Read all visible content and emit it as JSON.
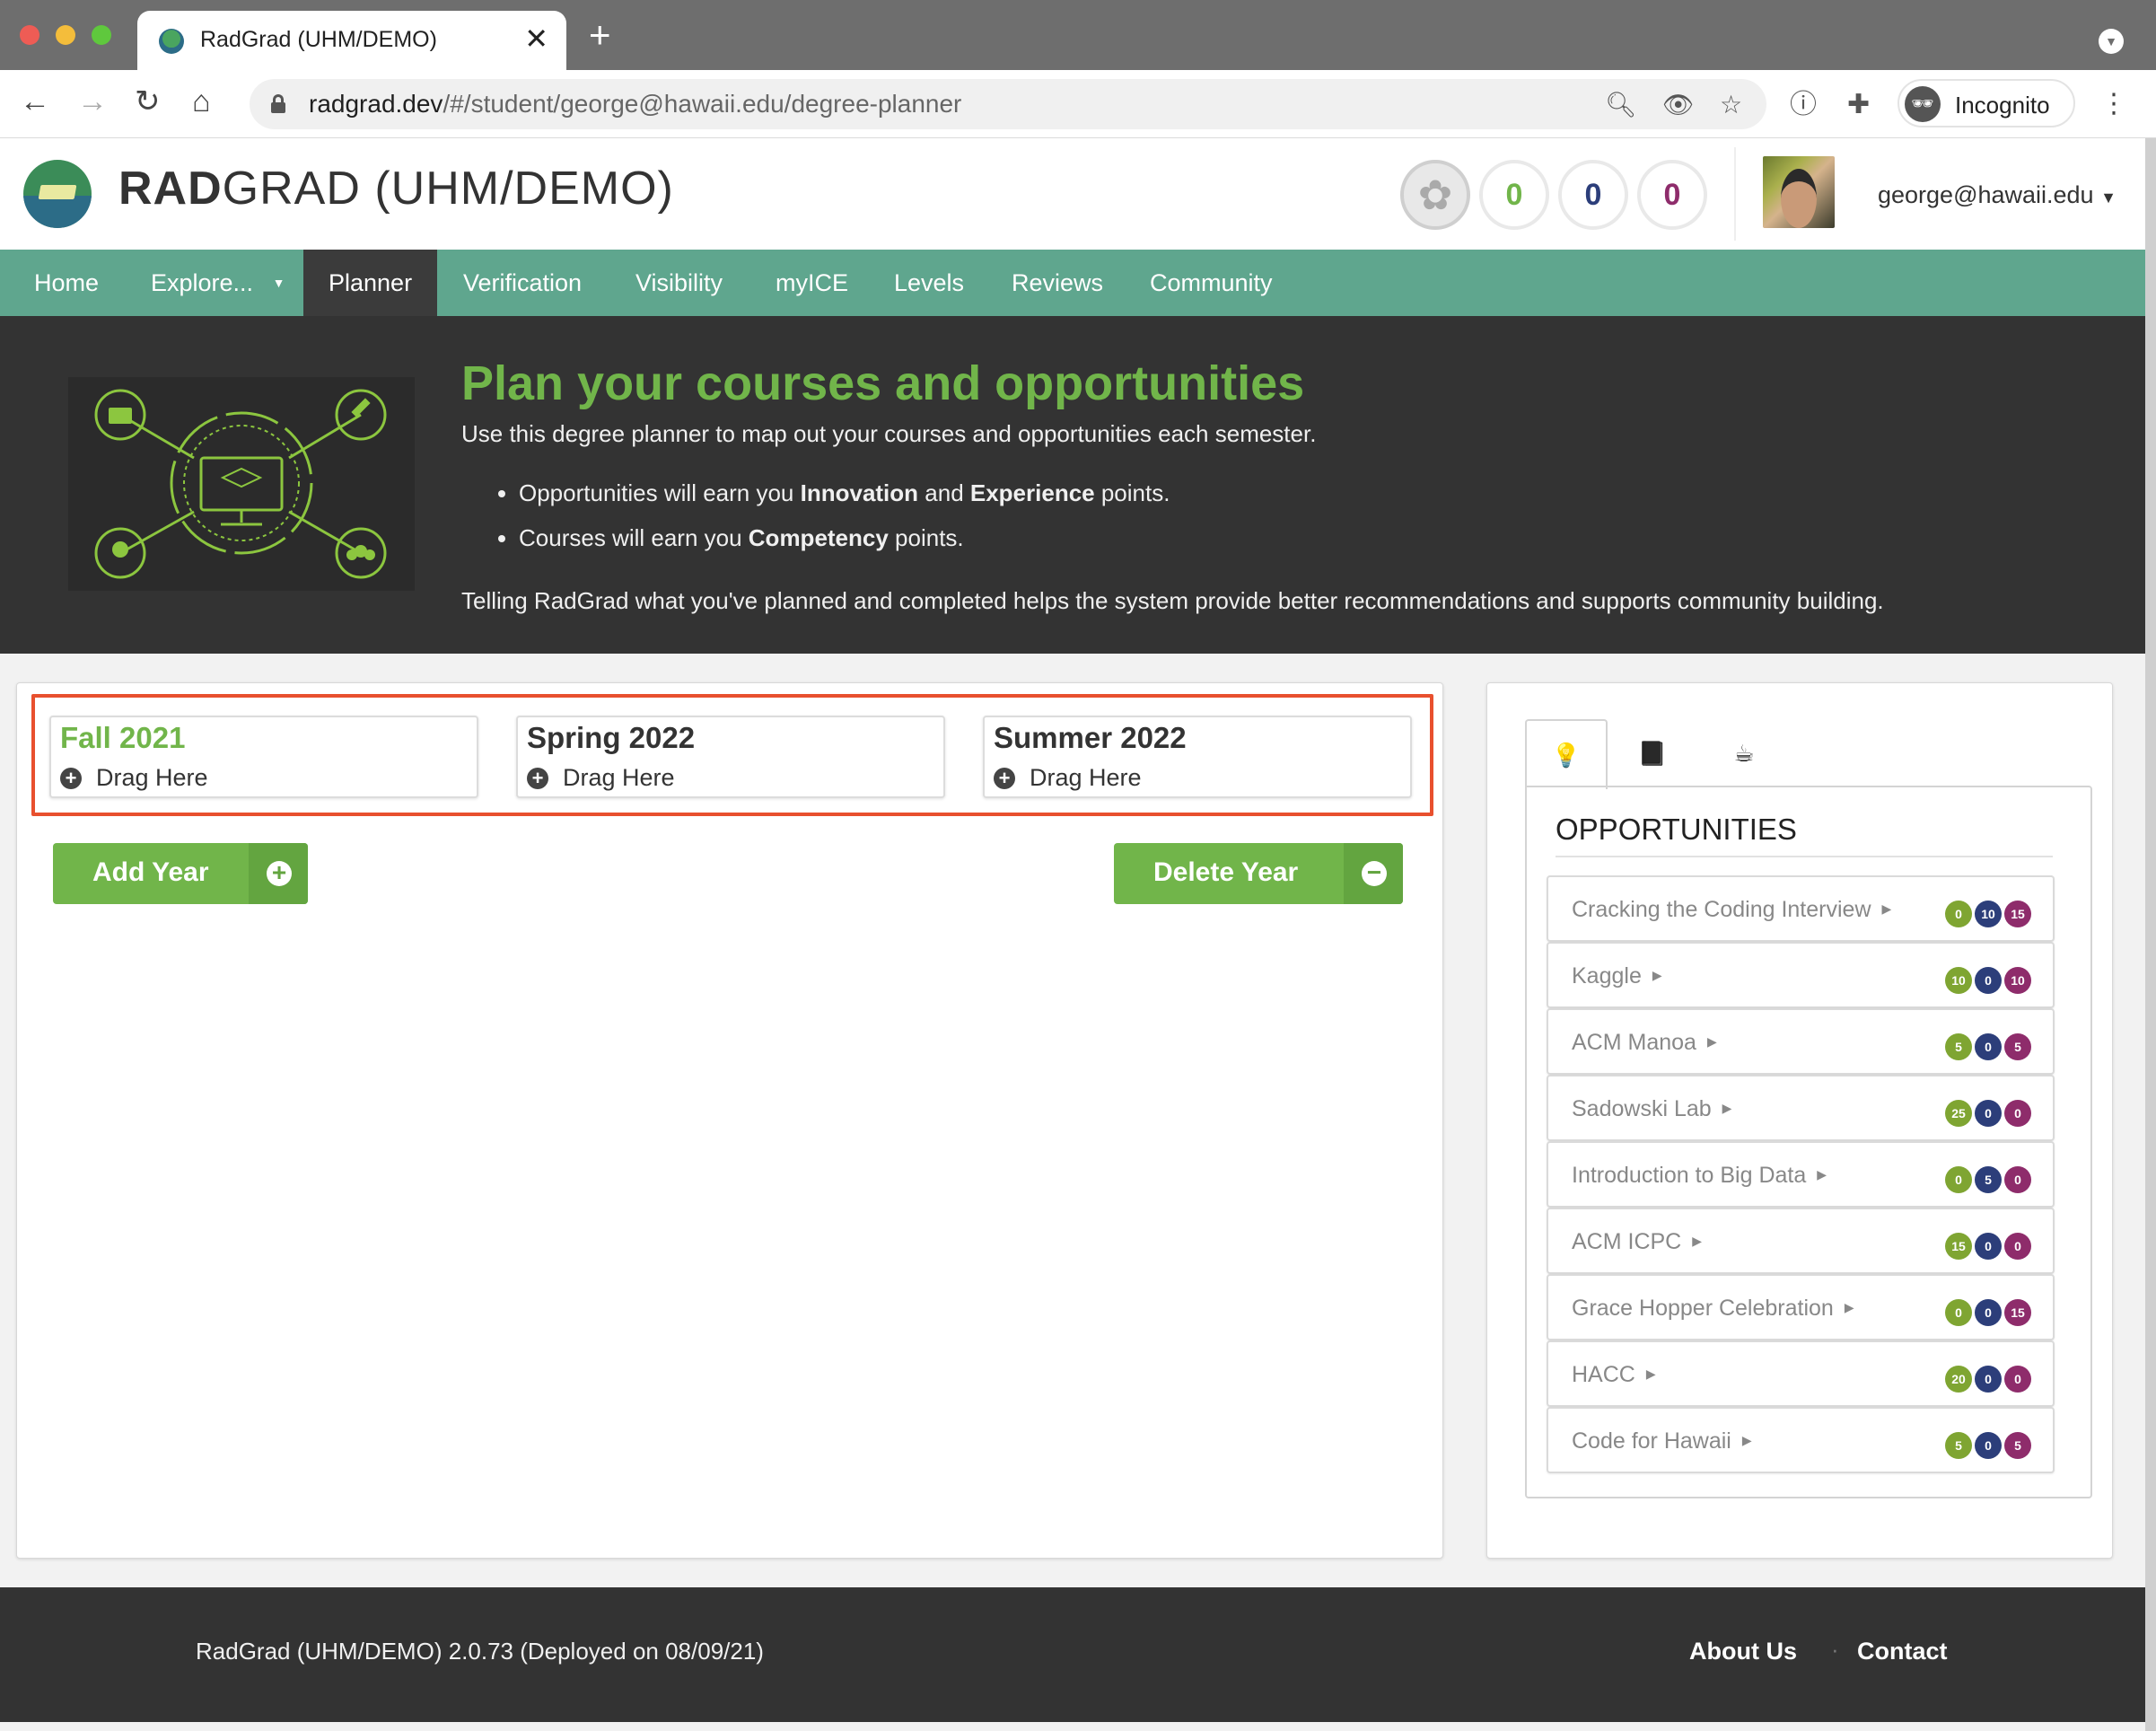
{
  "browser": {
    "tab_title": "RadGrad (UHM/DEMO)",
    "tab_close": "✕",
    "new_tab": "+",
    "url_host": "radgrad.dev",
    "url_path": "/#/student/george@hawaii.edu/degree-planner",
    "incognito_label": "Incognito"
  },
  "header": {
    "brand_bold": "RAD",
    "brand_rest": "GRAD (UHM/DEMO)",
    "ice": [
      {
        "value": "0",
        "color": "#71b54a"
      },
      {
        "value": "0",
        "color": "#2c3e7a"
      },
      {
        "value": "0",
        "color": "#8e2c6b"
      }
    ],
    "user_email": "george@hawaii.edu"
  },
  "nav": {
    "items": [
      {
        "label": "Home"
      },
      {
        "label": "Explore..."
      },
      {
        "label": "Planner"
      },
      {
        "label": "Verification"
      },
      {
        "label": "Visibility"
      },
      {
        "label": "myICE"
      },
      {
        "label": "Levels"
      },
      {
        "label": "Reviews"
      },
      {
        "label": "Community"
      }
    ],
    "active": "Planner"
  },
  "hero": {
    "title": "Plan your courses and opportunities",
    "subtitle": "Use this degree planner to map out your courses and opportunities each semester.",
    "bullet1_a": "Opportunities will earn you ",
    "bullet1_b": "Innovation",
    "bullet1_c": " and ",
    "bullet1_d": "Experience",
    "bullet1_e": " points.",
    "bullet2_a": "Courses will earn you ",
    "bullet2_b": "Competency",
    "bullet2_c": " points.",
    "footer_text": "Telling RadGrad what you've planned and completed helps the system provide better recommendations and supports community building."
  },
  "planner": {
    "semesters": [
      {
        "name": "Fall 2021",
        "drag_label": "Drag Here",
        "color": "#71b54a"
      },
      {
        "name": "Spring 2022",
        "drag_label": "Drag Here",
        "color": "#333333"
      },
      {
        "name": "Summer 2022",
        "drag_label": "Drag Here",
        "color": "#333333"
      }
    ],
    "add_year_label": "Add Year",
    "delete_year_label": "Delete Year"
  },
  "side": {
    "tabs": [
      {
        "icon": "lightbulb-icon",
        "glyph": "💡"
      },
      {
        "icon": "book-icon",
        "glyph": "📕"
      },
      {
        "icon": "coffee-icon",
        "glyph": "☕"
      }
    ],
    "header": "OPPORTUNITIES",
    "opportunities": [
      {
        "name": "Cracking the Coding Interview",
        "i": "0",
        "c": "10",
        "e": "15"
      },
      {
        "name": "Kaggle",
        "i": "10",
        "c": "0",
        "e": "10"
      },
      {
        "name": "ACM Manoa",
        "i": "5",
        "c": "0",
        "e": "5"
      },
      {
        "name": "Sadowski Lab",
        "i": "25",
        "c": "0",
        "e": "0"
      },
      {
        "name": "Introduction to Big Data",
        "i": "0",
        "c": "5",
        "e": "0"
      },
      {
        "name": "ACM ICPC",
        "i": "15",
        "c": "0",
        "e": "0"
      },
      {
        "name": "Grace Hopper Celebration",
        "i": "0",
        "c": "0",
        "e": "15"
      },
      {
        "name": "HACC",
        "i": "20",
        "c": "0",
        "e": "0"
      },
      {
        "name": "Code for Hawaii",
        "i": "5",
        "c": "0",
        "e": "5"
      }
    ],
    "badge_colors": {
      "i": "#7fa532",
      "c": "#2c3e7a",
      "e": "#8e2c6b"
    }
  },
  "footer": {
    "version": "RadGrad (UHM/DEMO) 2.0.73 (Deployed on 08/09/21)",
    "about": "About Us",
    "separator": "·",
    "contact": "Contact"
  }
}
